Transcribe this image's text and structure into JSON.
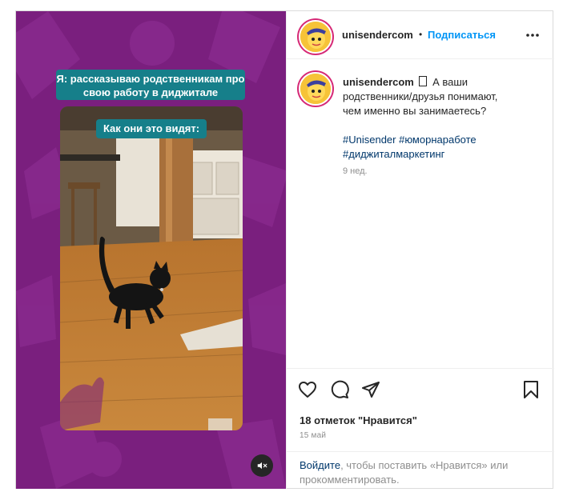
{
  "post": {
    "username": "unisendercom",
    "dot": "•",
    "follow_label": "Подписаться",
    "more_icon": "more-horizontal-icon",
    "media": {
      "overlay_top": "Я: рассказываю родственникам про свою работу в диджитале",
      "overlay_second": "Как они это видят:",
      "mute_icon": "speaker-muted-icon"
    },
    "caption": {
      "username": "unisendercom",
      "emoji": "",
      "text_lines": [
        "А ваши",
        "родственники/друзья понимают,",
        "чем именно вы занимаетесь?"
      ],
      "hashtags_line1": "#Unisender #юморнаработе",
      "hashtags_line2": "#диджиталмаркетинг",
      "age": "9 нед."
    },
    "actions": {
      "like_icon": "heart-icon",
      "comment_icon": "comment-icon",
      "share_icon": "send-icon",
      "save_icon": "bookmark-icon"
    },
    "likes_text": "18 отметок \"Нравится\"",
    "date": "15 май",
    "login": {
      "link": "Войдите",
      "rest": ", чтобы поставить «Нравится» или прокомментировать."
    },
    "colors": {
      "media_bg": "#7a1f7e",
      "overlay_teal": "#167f8a",
      "link_blue": "#0095f6",
      "hashtag": "#00376b"
    }
  }
}
